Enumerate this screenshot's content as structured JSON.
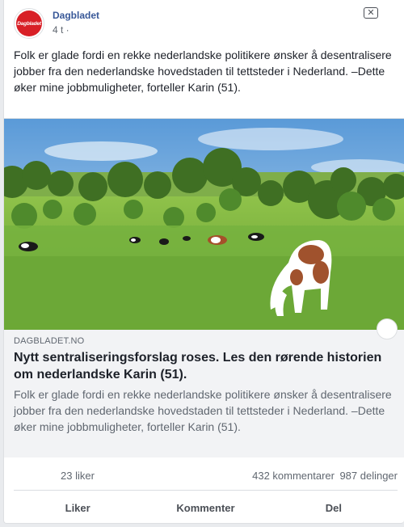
{
  "header": {
    "page_name": "Dagbladet",
    "avatar_text": "Dagbladet",
    "time": "4 t ·",
    "close_icon": "close-icon"
  },
  "post": {
    "text": "Folk er glade fordi en rekke nederlandske politikere ønsker å desentralisere jobber fra den nederlandske hovedstaden til tettsteder i Nederland. –Dette øker mine jobbmuligheter, forteller Karin (51)."
  },
  "link": {
    "domain": "DAGBLADET.NO",
    "title": "Nytt sentraliseringsforslag roses. Les den rørende historien om nederlandske Karin (51).",
    "description": "Folk er glade fordi en rekke nederlandske politikere ønsker å desentralisere jobber fra den nederlandske hovedstaden til tettsteder i Nederland. –Dette øker mine jobbmuligheter, forteller Karin (51)."
  },
  "stats": {
    "likes": "23 liker",
    "comments": "432 kommentarer",
    "shares": "987 delinger"
  },
  "actions": {
    "like": "Liker",
    "comment": "Kommenter",
    "share": "Del"
  },
  "colors": {
    "brand_red": "#d81f26",
    "link_blue": "#385898",
    "muted": "#606770"
  }
}
